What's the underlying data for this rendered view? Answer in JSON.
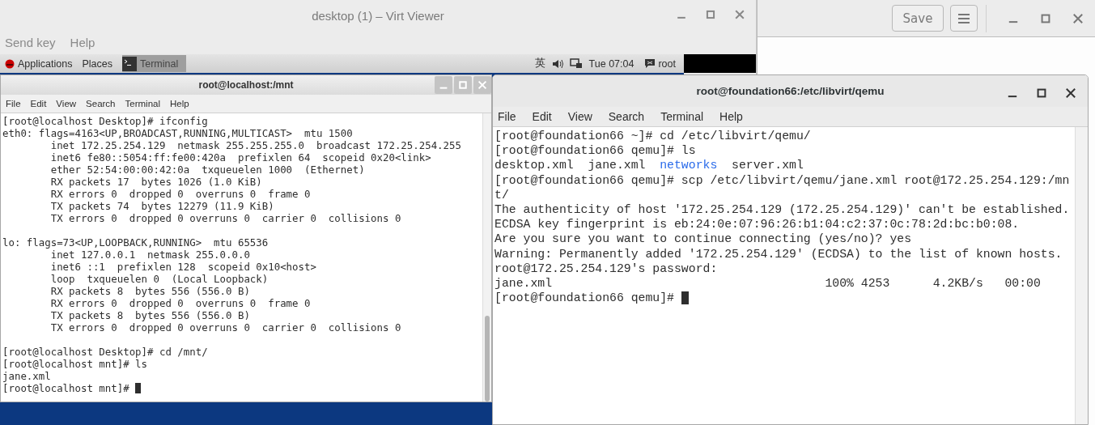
{
  "editor_window": {
    "buttons": [
      {
        "kind": "text",
        "label": "Save"
      },
      {
        "kind": "menu"
      }
    ]
  },
  "virt_viewer": {
    "title": "desktop (1) – Virt Viewer",
    "menu": [
      "Send key",
      "Help"
    ],
    "guest_panel": {
      "menus": [
        "Applications",
        "Places"
      ],
      "task": "Terminal",
      "input_method": "英",
      "clock": "Tue 07:04",
      "user": "root"
    }
  },
  "guest_terminal": {
    "title": "root@localhost:/mnt",
    "menu": [
      "File",
      "Edit",
      "View",
      "Search",
      "Terminal",
      "Help"
    ],
    "blocks": [
      [
        "[root@localhost Desktop]# ifconfig",
        "eth0: flags=4163<UP,BROADCAST,RUNNING,MULTICAST>  mtu 1500",
        "        inet 172.25.254.129  netmask 255.255.255.0  broadcast 172.25.254.255",
        "        inet6 fe80::5054:ff:fe00:420a  prefixlen 64  scopeid 0x20<link>",
        "        ether 52:54:00:00:42:0a  txqueuelen 1000  (Ethernet)",
        "        RX packets 17  bytes 1026 (1.0 KiB)",
        "        RX errors 0  dropped 0  overruns 0  frame 0",
        "        TX packets 74  bytes 12279 (11.9 KiB)",
        "        TX errors 0  dropped 0 overruns 0  carrier 0  collisions 0"
      ],
      [
        "lo: flags=73<UP,LOOPBACK,RUNNING>  mtu 65536",
        "        inet 127.0.0.1  netmask 255.0.0.0",
        "        inet6 ::1  prefixlen 128  scopeid 0x10<host>",
        "        loop  txqueuelen 0  (Local Loopback)",
        "        RX packets 8  bytes 556 (556.0 B)",
        "        RX errors 0  dropped 0  overruns 0  frame 0",
        "        TX packets 8  bytes 556 (556.0 B)",
        "        TX errors 0  dropped 0 overruns 0  carrier 0  collisions 0"
      ],
      [
        "[root@localhost Desktop]# cd /mnt/",
        "[root@localhost mnt]# ls",
        "jane.xml",
        {
          "text": "[root@localhost mnt]#",
          "cursor": true
        }
      ]
    ]
  },
  "host_terminal": {
    "title": "root@foundation66:/etc/libvirt/qemu",
    "menu": [
      "File",
      "Edit",
      "View",
      "Search",
      "Terminal",
      "Help"
    ],
    "blocks": [
      [
        "[root@foundation66 ~]# cd /etc/libvirt/qemu/",
        "[root@foundation66 qemu]# ls",
        {
          "items": [
            {
              "text": "desktop.xml",
              "kind": "file"
            },
            {
              "text": "jane.xml",
              "kind": "file"
            },
            {
              "text": "networks",
              "kind": "directory"
            },
            {
              "text": "server.xml",
              "kind": "file"
            }
          ]
        },
        "[root@foundation66 qemu]# scp /etc/libvirt/qemu/jane.xml root@172.25.254.129:/mn",
        "t/",
        "The authenticity of host '172.25.254.129 (172.25.254.129)' can't be established.",
        "ECDSA key fingerprint is eb:24:0e:07:96:26:b1:04:c2:37:0c:78:2d:bc:b0:08.",
        "Are you sure you want to continue connecting (yes/no)? yes",
        "Warning: Permanently added '172.25.254.129' (ECDSA) to the list of known hosts.",
        "root@172.25.254.129's password:",
        "jane.xml                                      100% 4253      4.2KB/s   00:00",
        {
          "text": "[root@foundation66 qemu]#",
          "cursor": true
        }
      ]
    ]
  }
}
